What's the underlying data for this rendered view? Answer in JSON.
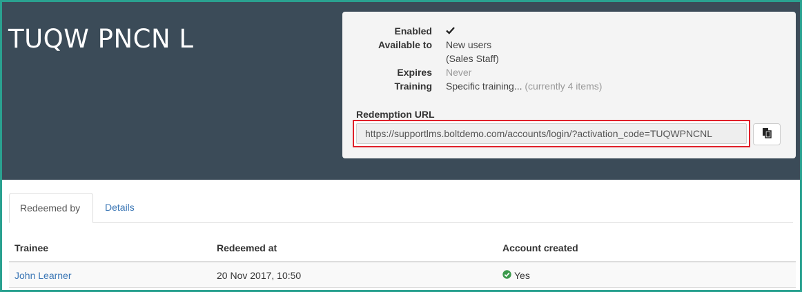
{
  "header": {
    "title": "TUQW PNCN L"
  },
  "info": {
    "enabled_label": "Enabled",
    "enabled_icon": "checkmark-icon",
    "available_label": "Available to",
    "available_value": "New users",
    "available_sub": "(Sales Staff)",
    "expires_label": "Expires",
    "expires_value": "Never",
    "training_label": "Training",
    "training_value": "Specific training...",
    "training_count": "(currently 4 items)"
  },
  "redemption": {
    "label": "Redemption URL",
    "url": "https://supportlms.boltdemo.com/accounts/login/?activation_code=TUQWPNCNL",
    "copy_icon": "clipboard-icon",
    "highlight_color": "#e0202a"
  },
  "tabs": [
    {
      "label": "Redeemed by",
      "active": true
    },
    {
      "label": "Details",
      "active": false
    }
  ],
  "table": {
    "headers": [
      "Trainee",
      "Redeemed at",
      "Account created"
    ],
    "rows": [
      {
        "trainee": "John Learner",
        "redeemed_at": "20 Nov 2017, 10:50",
        "account_created": "Yes",
        "status_icon": "check-circle-icon"
      }
    ]
  },
  "colors": {
    "header_bg": "#3b4b58",
    "link": "#3a76b5",
    "success": "#3c9a4c",
    "border": "#2aa190"
  }
}
